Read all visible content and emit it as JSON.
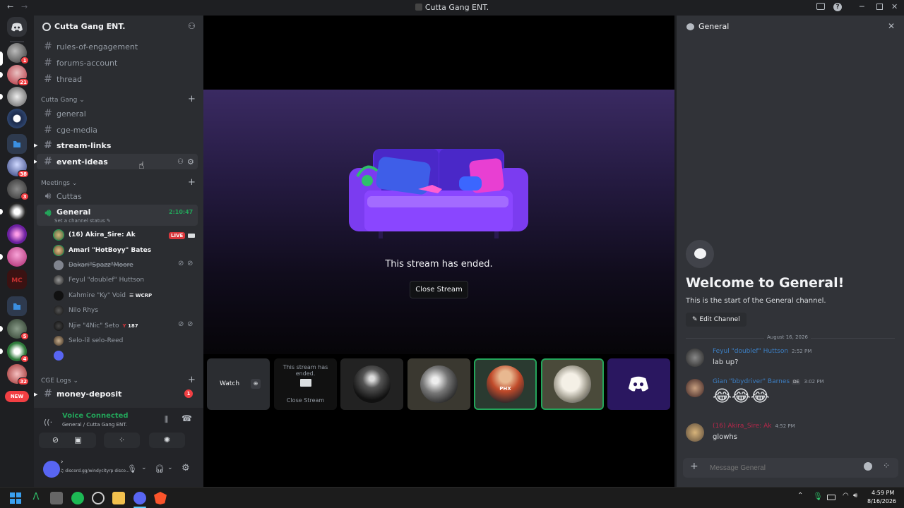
{
  "window": {
    "title": "Cutta Gang ENT.",
    "back": "←",
    "forward": "→"
  },
  "servers": [
    {
      "badge": "1"
    },
    {
      "badge": "21"
    },
    {
      "badge": ""
    },
    {
      "badge": ""
    },
    {
      "badge": ""
    },
    {
      "badge": "38"
    },
    {
      "badge": "3"
    },
    {
      "badge": ""
    },
    {
      "badge": ""
    },
    {
      "badge": ""
    },
    {
      "badge": ""
    },
    {
      "badge": ""
    },
    {
      "badge": "5"
    },
    {
      "badge": "4"
    },
    {
      "badge": "32"
    }
  ],
  "rail_new_label": "NEW",
  "guild": {
    "name": "Cutta Gang ENT."
  },
  "channels_top": [
    "rules-of-engagement",
    "forums-account",
    "thread"
  ],
  "category_cutta": "Cutta Gang",
  "channels_cutta": [
    "general",
    "cge-media",
    "stream-links",
    "event-ideas"
  ],
  "category_meetings": "Meetings",
  "voice_channels": {
    "cuttas": "Cuttas",
    "general": "General",
    "general_timer": "2:10:47",
    "status_hint": "Set a channel status"
  },
  "voice_users": [
    {
      "name": "(16) Akira_Sire: Ak",
      "live": "LIVE"
    },
    {
      "name": "Amari \"HotBoyy\" Bates"
    },
    {
      "name": "Dakari\"Spazz\"Moore"
    },
    {
      "name": "Feyul \"doublef\" Huttson"
    },
    {
      "name": "Kahmire \"Ky\" Void",
      "tag": "WCRP"
    },
    {
      "name": "Nilo Rhys"
    },
    {
      "name": "Njie \"4Nic\" Seto",
      "tag": "187"
    },
    {
      "name": "Selo-lil selo-Reed"
    }
  ],
  "category_logs": "CGE Logs",
  "channel_logs": {
    "name": "money-deposit",
    "badge": "1"
  },
  "voice_panel": {
    "status": "Voice Connected",
    "location": "General / Cutta Gang ENT."
  },
  "user_panel": {
    "custom_status": "discord.gg/windycityrp disco..."
  },
  "stream": {
    "ended_text": "This stream has ended.",
    "close_label": "Close Stream"
  },
  "tiles": {
    "watch": "Watch",
    "ended_small": "This stream has ended.",
    "close_small": "Close Stream",
    "jersey": "PHX"
  },
  "chat": {
    "channel": "General",
    "welcome_title": "Welcome to General!",
    "welcome_sub": "This is the start of the General channel.",
    "edit_channel": "Edit Channel",
    "date_divider": "August 16, 2026",
    "messages": [
      {
        "author": "Feyul \"doublef\" Huttson",
        "time": "2:52 PM",
        "text": "lab up?",
        "color": "#3c7fc4"
      },
      {
        "author": "Gian \"bbydriver\" Barnes",
        "time": "3:02 PM",
        "text": "😂😂😂",
        "color": "#3c7fc4",
        "tag": "DE"
      },
      {
        "author": "(16) Akira_Sire: Ak",
        "time": "4:52 PM",
        "text": "glowhs",
        "color": "#b9274b"
      }
    ],
    "input_placeholder": "Message General"
  },
  "taskbar": {
    "time": "4:59 PM",
    "date": "8/16/2026"
  },
  "colors": {
    "accent": "#5865f2",
    "live": "#da373c",
    "green": "#23a55a"
  }
}
